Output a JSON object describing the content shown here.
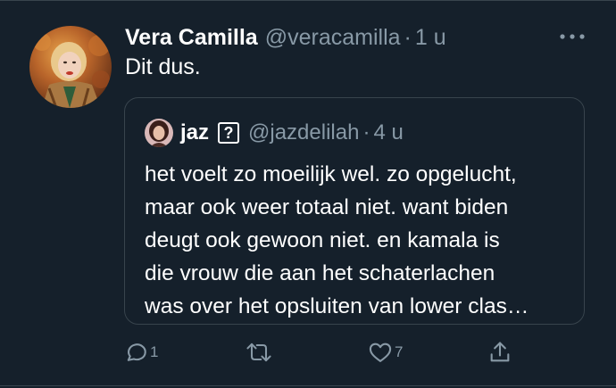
{
  "tweet": {
    "author": {
      "display_name": "Vera Camilla",
      "handle": "@veracamilla",
      "separator": "·",
      "time": "1 u"
    },
    "text": "Dit dus.",
    "more_icon": "more-horizontal-icon"
  },
  "quoted_tweet": {
    "author": {
      "display_name": "jaz",
      "badge": "?",
      "handle": "@jazdelilah",
      "separator": "·",
      "time": "4 u"
    },
    "text_lines": [
      "het voelt zo moeilijk wel. zo opgelucht,",
      "maar ook weer totaal niet. want biden",
      "deugt ook gewoon niet. en kamala is",
      "die vrouw die aan het schaterlachen",
      "was over het opsluiten van lower clas…"
    ]
  },
  "actions": {
    "reply": {
      "icon": "reply-icon",
      "count": "1"
    },
    "retweet": {
      "icon": "retweet-icon",
      "count": ""
    },
    "like": {
      "icon": "heart-icon",
      "count": "7"
    },
    "share": {
      "icon": "share-icon",
      "count": ""
    }
  },
  "colors": {
    "background": "#15202b",
    "border": "#38444d",
    "secondary_text": "#8899a6",
    "primary_text": "#ffffff"
  }
}
